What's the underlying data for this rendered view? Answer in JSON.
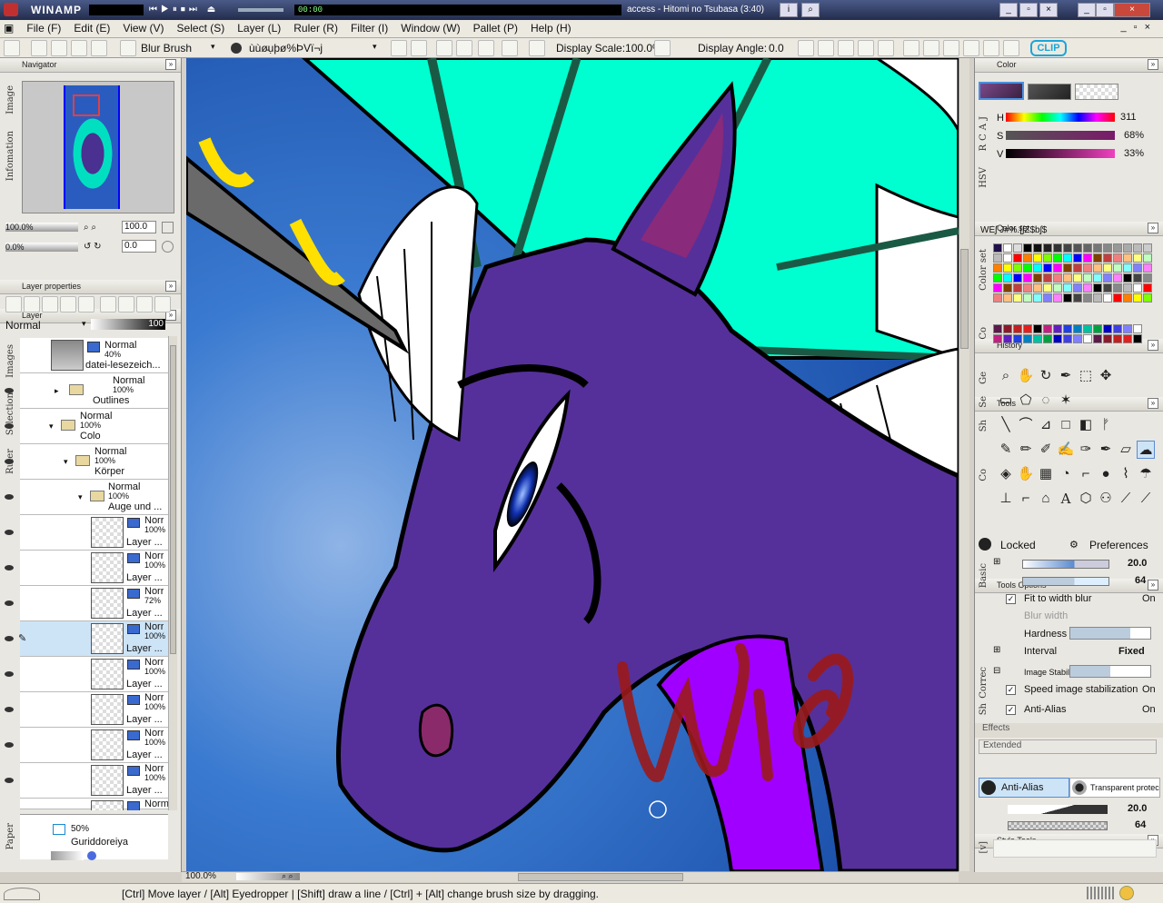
{
  "winamp": {
    "app": "WINAMP",
    "time": "00:00",
    "track": "access - Hitomi no Tsubasa (3:40)"
  },
  "menu": [
    "File (F)",
    "Edit (E)",
    "View (V)",
    "Select (S)",
    "Layer (L)",
    "Ruler (R)",
    "Filter (I)",
    "Window (W)",
    "Pallet (P)",
    "Help (H)"
  ],
  "toolbar": {
    "tool_name": "Blur Brush",
    "brush_text": "ùùø̵ụþø%ÞVï¬j",
    "display_scale": "Display Scale:100.0%",
    "display_angle_label": "Display Angle:",
    "display_angle": "0.0",
    "logo": "CLIP"
  },
  "navigator": {
    "title": "Navigator",
    "tab_image": "Image",
    "tab_info": "Infomation",
    "zoom": "100.0%",
    "zoom_value": "100.0",
    "angle": "0.0%",
    "angle_value": "0.0"
  },
  "layer_properties": {
    "title": "Layer properties"
  },
  "layer_panel": {
    "title": "Layer",
    "blend_mode": "Normal",
    "opacity": "100",
    "side_tabs": [
      "Images",
      "Selection",
      "Ruler"
    ],
    "layers": [
      {
        "mode": "Normal",
        "opacity": "40%",
        "name": "datei-lesezeich..."
      },
      {
        "mode": "Normal",
        "opacity": "100%",
        "name": "Outlines"
      },
      {
        "mode": "Normal",
        "opacity": "100%",
        "name": "Colo"
      },
      {
        "mode": "Normal",
        "opacity": "100%",
        "name": "Körper"
      },
      {
        "mode": "Normal",
        "opacity": "100%",
        "name": "Auge und ..."
      },
      {
        "mode": "Norr",
        "opacity": "100%",
        "name": "Layer ..."
      },
      {
        "mode": "Norr",
        "opacity": "100%",
        "name": "Layer ..."
      },
      {
        "mode": "Norr",
        "opacity": "72%",
        "name": "Layer ..."
      },
      {
        "mode": "Norr",
        "opacity": "100%",
        "name": "Layer ..."
      },
      {
        "mode": "Norr",
        "opacity": "100%",
        "name": "Layer ..."
      },
      {
        "mode": "Norr",
        "opacity": "100%",
        "name": "Layer ..."
      },
      {
        "mode": "Norr",
        "opacity": "100%",
        "name": "Layer ..."
      },
      {
        "mode": "Norr",
        "opacity": "100%",
        "name": "Layer ..."
      },
      {
        "mode": "Norm",
        "opacity": "",
        "name": ""
      }
    ],
    "paper_tab": "Paper",
    "guide": {
      "opacity": "50%",
      "name": "Guriddoreiya"
    }
  },
  "color": {
    "title": "Color",
    "side_tabs": "RCAJ",
    "hsv_tab": "HSV",
    "h": "311",
    "s": "68%",
    "v": "33%",
    "h_label": "H",
    "s_label": "S",
    "v_label": "V"
  },
  "color_set": {
    "title": "Color set",
    "name": "WÈʃ J#%.[ʃZ$bʃ$",
    "side": "Color set"
  },
  "history": {
    "title": "History",
    "side": "Co"
  },
  "tools": {
    "title": "Tools",
    "side_labels": [
      "Ge",
      "Se",
      "Sh",
      "Co"
    ]
  },
  "tool_options": {
    "title": "Tools Options",
    "locked": "Locked",
    "preferences": "Preferences",
    "size": "20.0",
    "density": "64",
    "side_basic": "Basic",
    "fit_blur": "Fit to width blur",
    "fit_blur_state": "On",
    "blur_width": "Blur width",
    "hardness": "Hardness",
    "interval": "Interval",
    "interval_value": "Fixed",
    "side_correction": "Correc",
    "image_stab": "Image Stabil...",
    "speed_stab": "Speed image stabilization",
    "speed_stab_state": "On",
    "side_sh": "Sh",
    "anti_alias": "Anti-Alias",
    "anti_alias_state": "On",
    "effects": "Effects",
    "extended": "Extended"
  },
  "style_tools": {
    "title": "Style Tools",
    "anti_alias": "Anti-Alias",
    "transparent": "Transparent protec...",
    "size": "20.0",
    "density": "64",
    "side": "[v]"
  },
  "canvas": {
    "zoom": "100.0%",
    "scribble": "Wio"
  },
  "status": "[Ctrl] Move layer / [Alt] Eyedropper | [Shift] draw a line / [Ctrl] + [Alt] change brush size by dragging.",
  "colors": {
    "teal": "#00ffd0",
    "purple": "#55309a",
    "blue_bg": "#2f6ec8",
    "scribble": "#9b1a1a",
    "magenta": "#a000ff"
  }
}
